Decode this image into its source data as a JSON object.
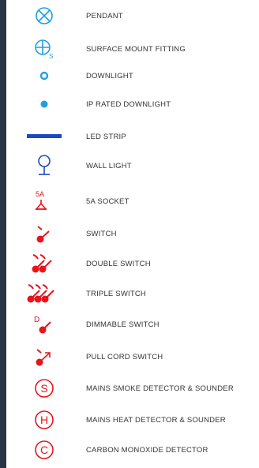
{
  "colors": {
    "blue": "#1fa0e0",
    "navy": "#1a47c8",
    "red": "#e8141c",
    "sidebar": "#2b3346"
  },
  "legend": {
    "items": [
      {
        "label": "PENDANT",
        "icon": "pendant-icon"
      },
      {
        "label": "SURFACE MOUNT FITTING",
        "icon": "surface-mount-icon",
        "symbol_text": "S"
      },
      {
        "label": "DOWNLIGHT",
        "icon": "downlight-icon"
      },
      {
        "label": "IP RATED DOWNLIGHT",
        "icon": "ip-downlight-icon"
      },
      {
        "label": "LED STRIP",
        "icon": "led-strip-icon"
      },
      {
        "label": "WALL LIGHT",
        "icon": "wall-light-icon"
      },
      {
        "label": "5A SOCKET",
        "icon": "socket-5a-icon",
        "symbol_text": "5A"
      },
      {
        "label": "SWITCH",
        "icon": "switch-icon"
      },
      {
        "label": "DOUBLE SWITCH",
        "icon": "double-switch-icon"
      },
      {
        "label": "TRIPLE SWITCH",
        "icon": "triple-switch-icon"
      },
      {
        "label": "DIMMABLE SWITCH",
        "icon": "dimmable-switch-icon",
        "symbol_text": "D"
      },
      {
        "label": "PULL CORD SWITCH",
        "icon": "pull-cord-switch-icon"
      },
      {
        "label": "MAINS SMOKE DETECTOR & SOUNDER",
        "icon": "smoke-detector-icon",
        "symbol_text": "S"
      },
      {
        "label": "MAINS HEAT DETECTOR & SOUNDER",
        "icon": "heat-detector-icon",
        "symbol_text": "H"
      },
      {
        "label": "CARBON MONOXIDE DETECTOR",
        "icon": "co-detector-icon",
        "symbol_text": "C"
      }
    ]
  }
}
